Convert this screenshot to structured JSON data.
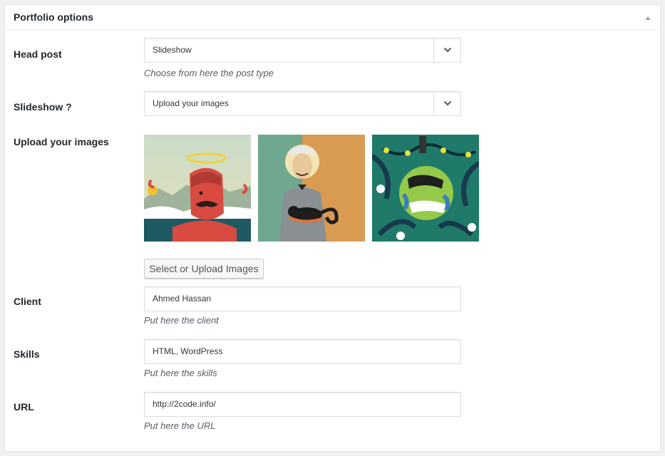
{
  "panel": {
    "title": "Portfolio options"
  },
  "head_post": {
    "label": "Head post",
    "value": "Slideshow",
    "description": "Choose from here the post type"
  },
  "slideshow": {
    "label": "Slideshow ?",
    "value": "Upload your images"
  },
  "upload_images": {
    "label": "Upload your images",
    "button_label": "Select or Upload Images",
    "images": [
      "devil-illustration",
      "old-man-with-cat-illustration",
      "zombie-earth-illustration"
    ]
  },
  "client": {
    "label": "Client",
    "value": "Ahmed Hassan",
    "description": "Put here the client"
  },
  "skills": {
    "label": "Skills",
    "value": "HTML, WordPress",
    "description": "Put here the skills"
  },
  "url": {
    "label": "URL",
    "value": "http://2code.info/",
    "description": "Put here the URL"
  },
  "icons": {
    "collapse": "triangle-up-icon",
    "select_arrow": "chevron-down-icon"
  },
  "colors": {
    "text": "#23282d",
    "description": "#555d66",
    "border": "#dddddd"
  }
}
